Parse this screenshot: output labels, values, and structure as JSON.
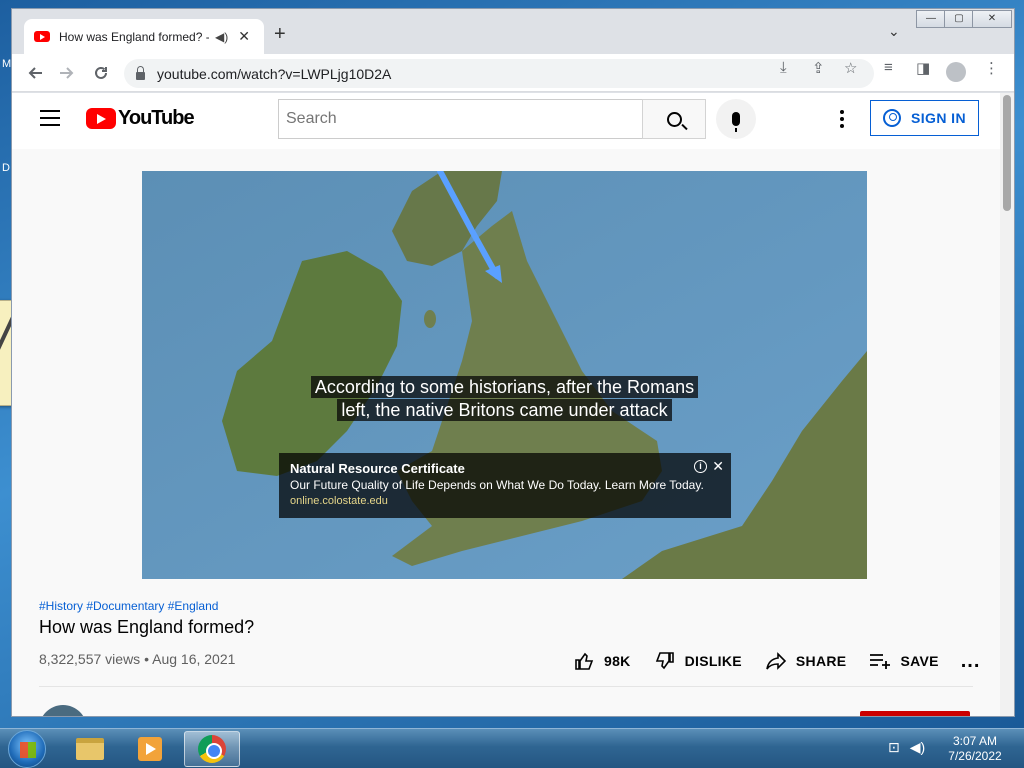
{
  "desktop": {
    "letters": [
      "M",
      "D"
    ]
  },
  "browser": {
    "tab_title": "How was England formed? -",
    "url": "youtube.com/watch?v=LWPLjg10D2A",
    "window_controls": {
      "minimize": "—",
      "maximize": "▢",
      "close": "✕"
    }
  },
  "youtube": {
    "logo_text": "YouTube",
    "search_placeholder": "Search",
    "sign_in": "SIGN IN"
  },
  "video": {
    "caption_line1": "According to some historians, after the Romans",
    "caption_line2": "left, the native Britons came under attack",
    "ad": {
      "title": "Natural Resource Certificate",
      "text": "Our Future Quality of Life Depends on What We Do Today. Learn More Today.",
      "url": "online.colostate.edu",
      "info": "i",
      "close": "✕"
    },
    "tags": "#History #Documentary #England",
    "title": "How was England formed?",
    "views": "8,322,557 views",
    "date": "Aug 16, 2021",
    "separator": "•"
  },
  "actions": {
    "like_count": "98K",
    "dislike": "DISLIKE",
    "share": "SHARE",
    "save": "SAVE",
    "more": "..."
  },
  "taskbar": {
    "time": "3:07 AM",
    "date": "7/26/2022"
  },
  "icons": {
    "back": "arrow-back-icon",
    "forward": "arrow-forward-icon",
    "reload": "reload-icon",
    "lock": "lock-icon"
  },
  "colors": {
    "yt_red": "#ff0000",
    "link_blue": "#065fd4",
    "ad_url": "#e6d68a"
  }
}
